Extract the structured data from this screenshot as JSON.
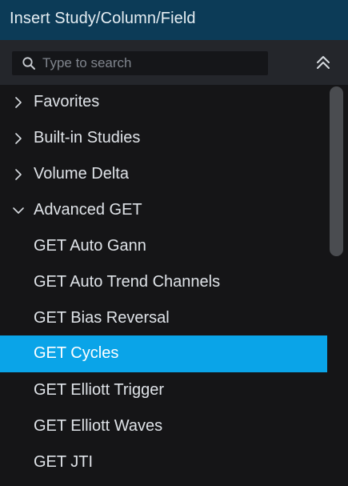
{
  "window": {
    "title": "Insert Study/Column/Field"
  },
  "search": {
    "placeholder": "Type to search",
    "value": ""
  },
  "list": {
    "items": [
      {
        "label": "Favorites",
        "type": "group",
        "expanded": false
      },
      {
        "label": "Built-in Studies",
        "type": "group",
        "expanded": false
      },
      {
        "label": "Volume Delta",
        "type": "group",
        "expanded": false
      },
      {
        "label": "Advanced GET",
        "type": "group",
        "expanded": true
      },
      {
        "label": "GET Auto Gann",
        "type": "item",
        "selected": false
      },
      {
        "label": "GET Auto Trend Channels",
        "type": "item",
        "selected": false
      },
      {
        "label": "GET Bias Reversal",
        "type": "item",
        "selected": false
      },
      {
        "label": "GET Cycles",
        "type": "item",
        "selected": true
      },
      {
        "label": "GET Elliott Trigger",
        "type": "item",
        "selected": false
      },
      {
        "label": "GET Elliott Waves",
        "type": "item",
        "selected": false
      },
      {
        "label": "GET JTI",
        "type": "item",
        "selected": false
      }
    ]
  },
  "colors": {
    "title_bar": "#0c3b57",
    "selection": "#0aa4e8",
    "background": "#151517"
  },
  "icons": {
    "search": "search-icon",
    "collapse": "collapse-all-icon",
    "collapsed_group": "chevron-right-icon",
    "expanded_group": "chevron-down-icon"
  }
}
